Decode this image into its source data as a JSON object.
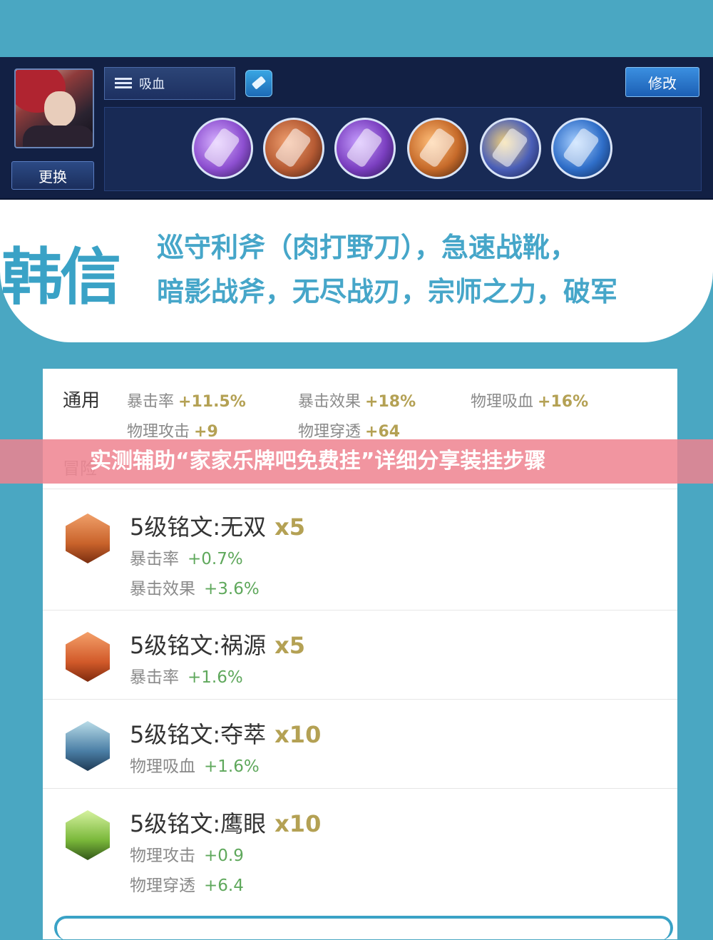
{
  "game_panel": {
    "change_label": "更换",
    "tag_label": "吸血",
    "modify_label": "修改",
    "items": [
      {
        "icon": "axe-item-icon",
        "color": "#8d4fd0"
      },
      {
        "icon": "boots-item-icon",
        "color": "#b55a33"
      },
      {
        "icon": "shadow-axe-item-icon",
        "color": "#7b3fc0"
      },
      {
        "icon": "infinity-blade-item-icon",
        "color": "#c66a2a"
      },
      {
        "icon": "master-power-item-icon",
        "color": "#4a5fb8"
      },
      {
        "icon": "armor-breaker-item-icon",
        "color": "#2f6ec8"
      }
    ]
  },
  "hero": {
    "name": "韩信",
    "build_line1": "巡守利斧（肉打野刀），急速战靴，",
    "build_line2": "暗影战斧，无尽战刃，宗师之力，破军"
  },
  "general": {
    "title": "通用",
    "stats": [
      {
        "label": "暴击率",
        "value": "+11.5%"
      },
      {
        "label": "暴击效果",
        "value": "+18%"
      },
      {
        "label": "物理吸血",
        "value": "+16%"
      },
      {
        "label": "物理攻击",
        "value": "+9"
      },
      {
        "label": "物理穿透",
        "value": "+64"
      }
    ],
    "partial_title": "冒险"
  },
  "runes": [
    {
      "name": "5级铭文:无双",
      "count": "x5",
      "color": "#c9632b",
      "stats": [
        {
          "label": "暴击率",
          "value": "+0.7%"
        },
        {
          "label": "暴击效果",
          "value": "+3.6%"
        }
      ]
    },
    {
      "name": "5级铭文:祸源",
      "count": "x5",
      "color": "#d25a2a",
      "stats": [
        {
          "label": "暴击率",
          "value": "+1.6%"
        }
      ]
    },
    {
      "name": "5级铭文:夺萃",
      "count": "x10",
      "color": "#4b7fa6",
      "stats": [
        {
          "label": "物理吸血",
          "value": "+1.6%"
        }
      ]
    },
    {
      "name": "5级铭文:鹰眼",
      "count": "x10",
      "color": "#7ab83a",
      "stats": [
        {
          "label": "物理攻击",
          "value": "+0.9"
        },
        {
          "label": "物理穿透",
          "value": "+6.4"
        }
      ]
    }
  ],
  "banner": {
    "text": "实测辅助“家家乐牌吧免费挂”详细分享装挂步骤"
  }
}
